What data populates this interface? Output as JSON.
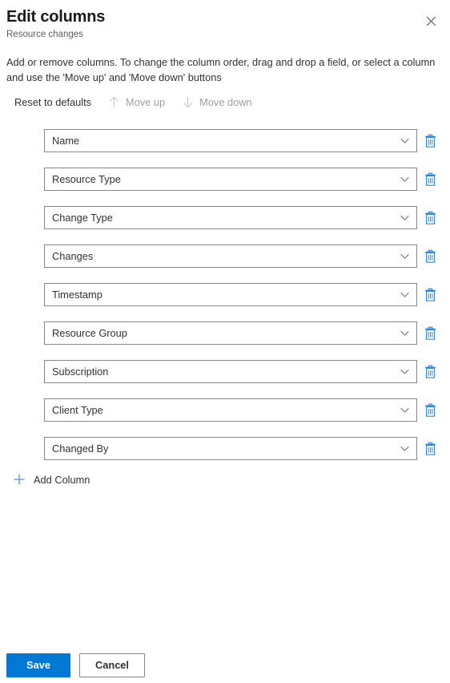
{
  "header": {
    "title": "Edit columns",
    "subtitle": "Resource changes",
    "close_icon": "close-icon"
  },
  "description": "Add or remove columns. To change the column order, drag and drop a field, or select a column and use the 'Move up' and 'Move down' buttons",
  "commandbar": {
    "reset": {
      "label": "Reset to defaults",
      "disabled": false
    },
    "move_up": {
      "label": "Move up",
      "icon": "arrow-up-icon",
      "disabled": true
    },
    "move_down": {
      "label": "Move down",
      "icon": "arrow-down-icon",
      "disabled": true
    }
  },
  "columns": [
    {
      "label": "Name"
    },
    {
      "label": "Resource Type"
    },
    {
      "label": "Change Type"
    },
    {
      "label": "Changes"
    },
    {
      "label": "Timestamp"
    },
    {
      "label": "Resource Group"
    },
    {
      "label": "Subscription"
    },
    {
      "label": "Client Type"
    },
    {
      "label": "Changed By"
    }
  ],
  "add_column": {
    "label": "Add Column",
    "icon": "plus-icon"
  },
  "footer": {
    "save_label": "Save",
    "cancel_label": "Cancel"
  },
  "colors": {
    "accent": "#0078d4",
    "delete_icon": "#2b88d8",
    "border": "#8a8886",
    "text": "#323130",
    "muted_text": "#605e5c",
    "disabled_text": "#a19f9d"
  }
}
